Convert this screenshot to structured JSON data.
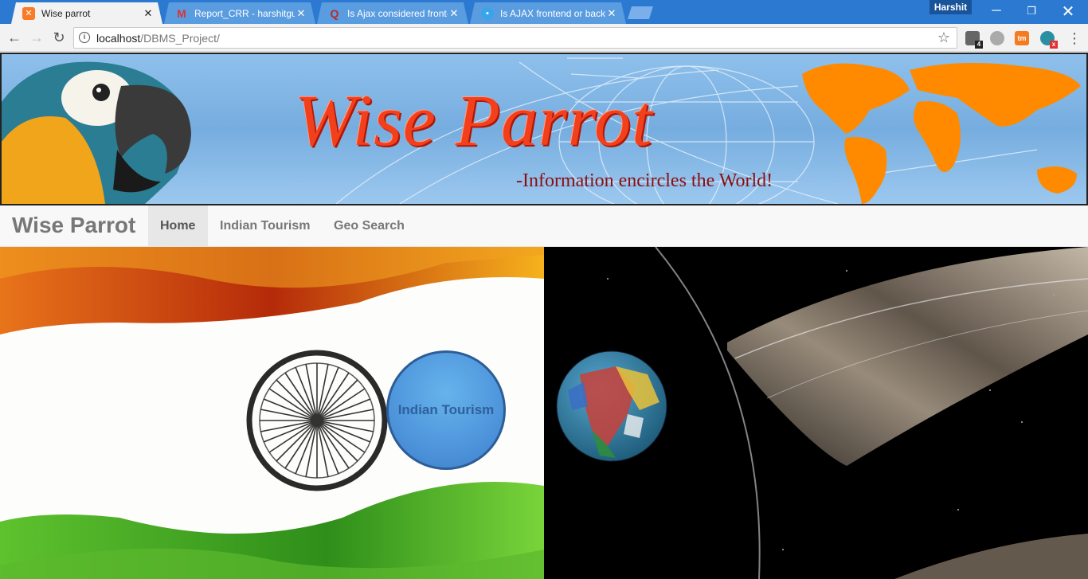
{
  "browser": {
    "tabs": [
      {
        "title": "Wise parrot",
        "active": true,
        "favicon": "xampp-icon"
      },
      {
        "title": "Report_CRR - harshitguj",
        "active": false,
        "favicon": "gmail-icon"
      },
      {
        "title": "Is Ajax considered front-",
        "active": false,
        "favicon": "quora-icon"
      },
      {
        "title": "Is AJAX frontend or back",
        "active": false,
        "favicon": "chat-bubble-icon"
      }
    ],
    "profile_name": "Harshit",
    "url_host": "localhost",
    "url_path": "/DBMS_Project/",
    "extension_badge_1": "4",
    "extension_badge_2": "x",
    "extension_tm": "tm"
  },
  "banner": {
    "title": "Wise Parrot",
    "tagline": "-Information encircles the World!"
  },
  "navbar": {
    "brand": "Wise Parrot",
    "links": [
      {
        "label": "Home",
        "active": true
      },
      {
        "label": "Indian Tourism",
        "active": false
      },
      {
        "label": "Geo Search",
        "active": false
      }
    ]
  },
  "hero": {
    "tourism_button": "Indian Tourism"
  },
  "colors": {
    "titlebar": "#2b79d0",
    "banner_title": "#f3401c",
    "tourism_button": "#4a90d8",
    "saffron": "#f0a020",
    "india_green": "#5cb82e"
  }
}
